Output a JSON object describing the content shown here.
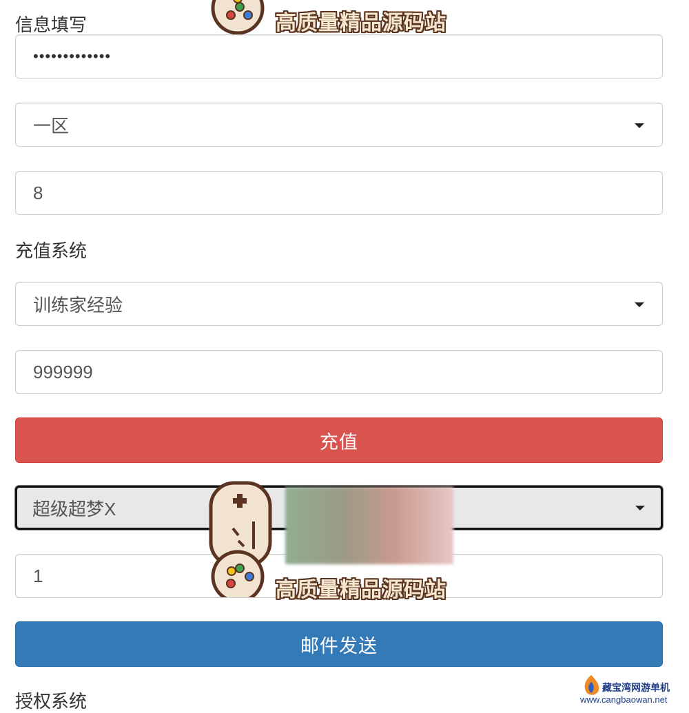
{
  "sections": {
    "info_label": "信息填写",
    "recharge_label": "充值系统",
    "auth_label": "授权系统"
  },
  "form": {
    "account_password": "•••••••••••••",
    "server_select": "一区",
    "server_id": "8",
    "recharge_type": "训练家经验",
    "recharge_amount": "999999",
    "recharge_button": "充值",
    "pet_select": "超级超梦X",
    "pet_quantity": "1",
    "send_mail_button": "邮件发送"
  },
  "watermark": {
    "text": "高质量精品源码站",
    "icon": "gamepad-icon",
    "corner_logo_text": "藏宝湾网游单机",
    "corner_logo_url": "www.cangbaowan.net"
  },
  "colors": {
    "danger": "#d9534f",
    "primary": "#337ab7"
  }
}
